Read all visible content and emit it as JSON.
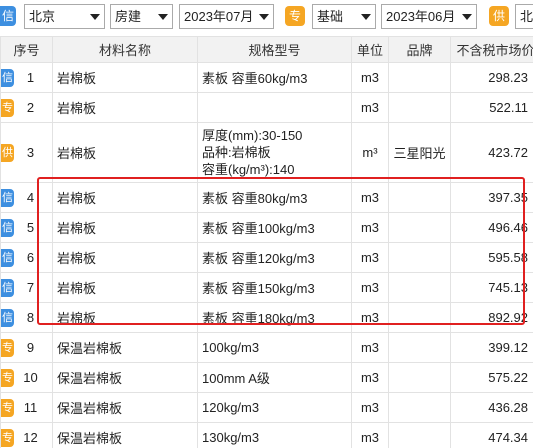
{
  "filters": {
    "badge1": "信",
    "region": "北京",
    "category": "房建",
    "period1": "2023年07月",
    "badge2": "专",
    "level": "基础",
    "period2": "2023年06月",
    "badge3": "供",
    "region2": "北京"
  },
  "table": {
    "headers": [
      "序号",
      "材料名称",
      "规格型号",
      "单位",
      "品牌",
      "不含税市场价"
    ],
    "rows": [
      {
        "tag": "信",
        "tag_color": "blue",
        "no": "1",
        "name": "岩棉板",
        "spec": "素板 容重60kg/m3",
        "unit": "m3",
        "brand": "",
        "price": "298.23"
      },
      {
        "tag": "专",
        "tag_color": "orange",
        "no": "2",
        "name": "岩棉板",
        "spec": "",
        "unit": "m3",
        "brand": "",
        "price": "522.11"
      },
      {
        "tag": "供",
        "tag_color": "orange",
        "no": "3",
        "name": "岩棉板",
        "spec_lines": [
          "厚度(mm):30-150",
          "品种:岩棉板",
          "容重(kg/m³):140"
        ],
        "unit": "m³",
        "brand": "三星阳光",
        "price": "423.72"
      },
      {
        "tag": "信",
        "tag_color": "blue",
        "no": "4",
        "name": "岩棉板",
        "spec": "素板 容重80kg/m3",
        "unit": "m3",
        "brand": "",
        "price": "397.35"
      },
      {
        "tag": "信",
        "tag_color": "blue",
        "no": "5",
        "name": "岩棉板",
        "spec": "素板 容重100kg/m3",
        "unit": "m3",
        "brand": "",
        "price": "496.46"
      },
      {
        "tag": "信",
        "tag_color": "blue",
        "no": "6",
        "name": "岩棉板",
        "spec": "素板 容重120kg/m3",
        "unit": "m3",
        "brand": "",
        "price": "595.58"
      },
      {
        "tag": "信",
        "tag_color": "blue",
        "no": "7",
        "name": "岩棉板",
        "spec": "素板 容重150kg/m3",
        "unit": "m3",
        "brand": "",
        "price": "745.13"
      },
      {
        "tag": "信",
        "tag_color": "blue",
        "no": "8",
        "name": "岩棉板",
        "spec": "素板 容重180kg/m3",
        "unit": "m3",
        "brand": "",
        "price": "892.92"
      },
      {
        "tag": "专",
        "tag_color": "orange",
        "no": "9",
        "name": "保温岩棉板",
        "spec": "100kg/m3",
        "unit": "m3",
        "brand": "",
        "price": "399.12"
      },
      {
        "tag": "专",
        "tag_color": "orange",
        "no": "10",
        "name": "保温岩棉板",
        "spec": "100mm A级",
        "unit": "m3",
        "brand": "",
        "price": "575.22"
      },
      {
        "tag": "专",
        "tag_color": "orange",
        "no": "11",
        "name": "保温岩棉板",
        "spec": "120kg/m3",
        "unit": "m3",
        "brand": "",
        "price": "436.28"
      },
      {
        "tag": "专",
        "tag_color": "orange",
        "no": "12",
        "name": "保温岩棉板",
        "spec": "130kg/m3",
        "unit": "m3",
        "brand": "",
        "price": "474.34"
      }
    ]
  }
}
